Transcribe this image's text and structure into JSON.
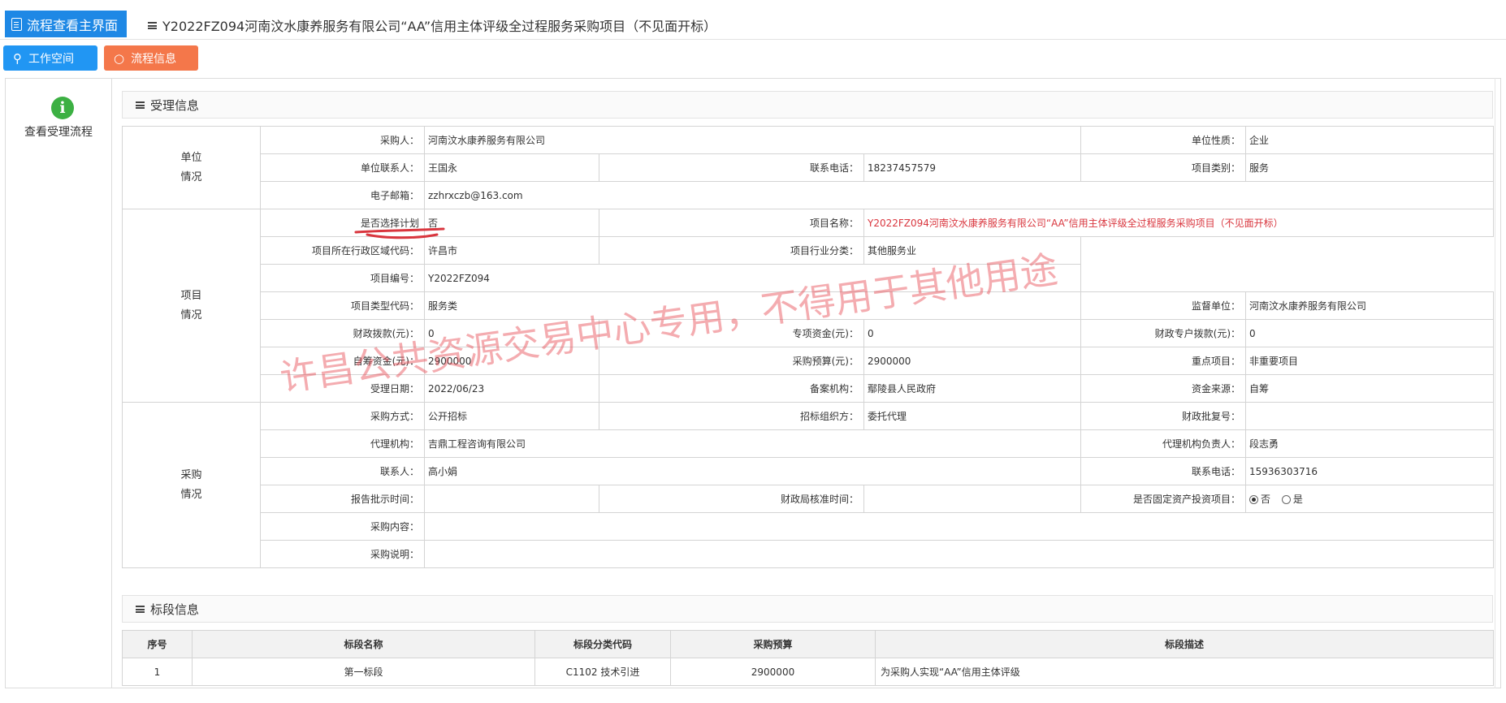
{
  "header": {
    "home_tab": "流程查看主界面",
    "page_title": "Y2022FZ094河南汶水康养服务有限公司“AA”信用主体评级全过程服务采购项目（不见面开标）"
  },
  "toolbar": {
    "workspace": "工作空间",
    "flow_info": "流程信息"
  },
  "sidebar": {
    "view_flow": "查看受理流程"
  },
  "section1": {
    "title": "受理信息",
    "groups": {
      "unit": "单位 情况",
      "project": "项目 情况",
      "purchase": "采购 情况"
    },
    "f": {
      "purchaser_l": "采购人：",
      "purchaser_v": "河南汶水康养服务有限公司",
      "unit_nature_l": "单位性质：",
      "unit_nature_v": "企业",
      "contact_l": "单位联系人：",
      "contact_v": "王国永",
      "phone_l": "联系电话：",
      "phone_v": "18237457579",
      "category_l": "项目类别：",
      "category_v": "服务",
      "email_l": "电子邮箱：",
      "email_v": "zzhrxczb@163.com",
      "plan_l": "是否选择计划",
      "plan_v": "否",
      "pname_l": "项目名称：",
      "pname_v": "Y2022FZ094河南汶水康养服务有限公司“AA”信用主体评级全过程服务采购项目（不见面开标）",
      "region_l": "项目所在行政区域代码：",
      "region_v": "许昌市",
      "industry_l": "项目行业分类：",
      "industry_v": "其他服务业",
      "pno_l": "项目编号：",
      "pno_v": "Y2022FZ094",
      "ptype_l": "项目类型代码：",
      "ptype_v": "服务类",
      "supervisor_l": "监督单位：",
      "supervisor_v": "河南汶水康养服务有限公司",
      "fiscal_l": "财政拨款(元)：",
      "fiscal_v": "0",
      "special_l": "专项资金(元)：",
      "special_v": "0",
      "fiscal_special_l": "财政专户拨款(元)：",
      "fiscal_special_v": "0",
      "self_l": "自筹资金(元)：",
      "self_v": "2900000",
      "budget_l": "采购预算(元)：",
      "budget_v": "2900000",
      "key_l": "重点项目：",
      "key_v": "非重要项目",
      "date_l": "受理日期：",
      "date_v": "2022/06/23",
      "record_l": "备案机构：",
      "record_v": "鄢陵县人民政府",
      "source_l": "资金来源：",
      "source_v": "自筹",
      "method_l": "采购方式：",
      "method_v": "公开招标",
      "org_form_l": "招标组织方：",
      "org_form_v": "委托代理",
      "approval_l": "财政批复号：",
      "approval_v": "",
      "agency_l": "代理机构：",
      "agency_v": "吉鼎工程咨询有限公司",
      "agency_head_l": "代理机构负责人：",
      "agency_head_v": "段志勇",
      "person_l": "联系人：",
      "person_v": "高小娟",
      "phone2_l": "联系电话：",
      "phone2_v": "15936303716",
      "report_l": "报告批示时间：",
      "report_v": "",
      "fin_time_l": "财政局核准时间：",
      "fin_time_v": "",
      "fixed_l": "是否固定资产投资项目：",
      "fixed_no": "否",
      "fixed_yes": "是",
      "content_l": "采购内容：",
      "content_v": "",
      "note_l": "采购说明：",
      "note_v": ""
    }
  },
  "section2": {
    "title": "标段信息",
    "headers": [
      "序号",
      "标段名称",
      "标段分类代码",
      "采购预算",
      "标段描述"
    ],
    "rows": [
      [
        "1",
        "第一标段",
        "C1102 技术引进",
        "2900000",
        "为采购人实现“AA”信用主体评级"
      ]
    ]
  },
  "watermark": "许昌公共资源交易中心专用，不得用于其他用途"
}
